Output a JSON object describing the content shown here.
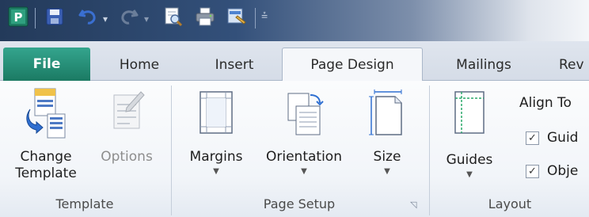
{
  "quick_access": {
    "app_icon": "publisher-icon",
    "save_icon": "save-icon",
    "undo_icon": "undo-icon",
    "redo_icon": "redo-icon",
    "print_preview_icon": "print-preview-icon",
    "print_icon": "print-icon",
    "format_painter_icon": "format-painter-icon",
    "customize_icon": "customize-qat-icon"
  },
  "tabs": {
    "file": "File",
    "home": "Home",
    "insert": "Insert",
    "page_design": "Page Design",
    "mailings": "Mailings",
    "review": "Rev"
  },
  "groups": {
    "template": {
      "label": "Template",
      "change_template_line1": "Change",
      "change_template_line2": "Template",
      "options": "Options"
    },
    "page_setup": {
      "label": "Page Setup",
      "margins": "Margins",
      "orientation": "Orientation",
      "size": "Size"
    },
    "layout": {
      "label": "Layout",
      "guides": "Guides",
      "align_to": "Align To",
      "guides_check": "Guid",
      "objects_check": "Obje"
    }
  },
  "colors": {
    "file_tab": "#1b7a63",
    "ribbon_bg": "#f2f5f9",
    "accent_blue": "#2b6cc4"
  }
}
